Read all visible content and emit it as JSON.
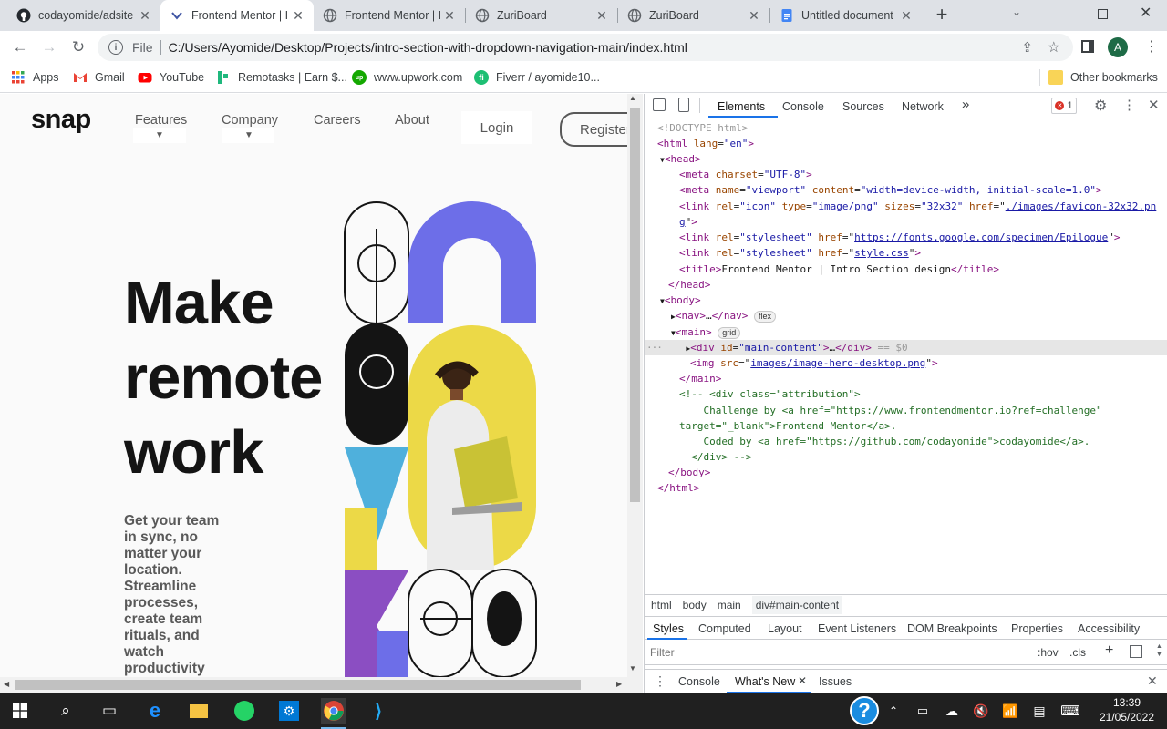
{
  "browser": {
    "tabs": [
      {
        "title": "codayomide/adsite",
        "icon": "github-icon"
      },
      {
        "title": "Frontend Mentor | I",
        "icon": "frontend-mentor-icon",
        "active": true
      },
      {
        "title": "Frontend Mentor | I",
        "icon": "globe-icon"
      },
      {
        "title": "ZuriBoard",
        "icon": "globe-icon"
      },
      {
        "title": "ZuriBoard",
        "icon": "globe-icon"
      },
      {
        "title": "Untitled document",
        "icon": "google-docs-icon"
      }
    ],
    "new_tab": "+",
    "address": {
      "scheme_label": "File",
      "url": "C:/Users/Ayomide/Desktop/Projects/intro-section-with-dropdown-navigation-main/index.html"
    },
    "profile_initial": "A",
    "bookmarks": [
      {
        "label": "Apps",
        "icon": "apps-grid-icon"
      },
      {
        "label": "Gmail",
        "icon": "gmail-icon"
      },
      {
        "label": "YouTube",
        "icon": "youtube-icon"
      },
      {
        "label": "Remotasks | Earn $...",
        "icon": "remotasks-icon"
      },
      {
        "label": "www.upwork.com",
        "icon": "upwork-icon"
      },
      {
        "label": "Fiverr / ayomide10...",
        "icon": "fiverr-icon"
      }
    ],
    "other_bookmarks": "Other bookmarks"
  },
  "site": {
    "logo": "snap",
    "nav": {
      "features": "Features",
      "company": "Company",
      "careers": "Careers",
      "about": "About"
    },
    "login": "Login",
    "register": "Register",
    "hero": {
      "line1": "Make",
      "line2": "remote",
      "line3": "work"
    },
    "description_lines": [
      "Get your team",
      "in sync, no",
      "matter your",
      "location.",
      "Streamline",
      "processes,",
      "create team",
      "rituals, and",
      "watch",
      "productivity"
    ],
    "colors": {
      "purple": "#6d6ee8",
      "yellow": "#ecd947",
      "blue": "#4fb0dc",
      "violet": "#8b4ec2",
      "dark": "#141414"
    }
  },
  "devtools": {
    "tabs": [
      "Elements",
      "Console",
      "Sources",
      "Network"
    ],
    "more": "»",
    "error_count": "1",
    "code": {
      "doctype": "<!DOCTYPE html>",
      "html_open": "html",
      "lang_attr": "lang",
      "lang_val": "\"en\"",
      "head": "head",
      "meta_charset": "charset",
      "meta_charset_val": "\"UTF-8\"",
      "meta_name": "name",
      "meta_name_val": "\"viewport\"",
      "meta_content": "content",
      "meta_content_val": "\"width=device-width, initial-scale=1.0\"",
      "link_rel": "rel",
      "icon_rel_val": "\"icon\"",
      "type_attr": "type",
      "type_val": "\"image/png\"",
      "sizes_attr": "sizes",
      "sizes_val": "\"32x32\"",
      "href_attr": "href",
      "favicon_href_a": "./images/favicon-32x32.pn",
      "favicon_href_b": "g",
      "stylesheet_val": "\"stylesheet\"",
      "fonts_href": "https://fonts.google.com/specimen/Epilogue",
      "style_href": "style.css",
      "title_text": "Frontend Mentor | Intro Section design",
      "nav_ellipsis": "…",
      "nav_badge": "flex",
      "main_badge": "grid",
      "div_id_attr": "id",
      "div_id_val": "\"main-content\"",
      "selected_suffix": "== $0",
      "img_src_attr": "src",
      "img_src_val": "images/image-hero-desktop.png",
      "comment1": "<!-- <div class=\"attribution\">",
      "comment2": "    Challenge by <a href=\"https://www.frontendmentor.io?ref=challenge\"",
      "comment3": "target=\"_blank\">Frontend Mentor</a>.",
      "comment4": "    Coded by <a href=\"https://github.com/codayomide\">codayomide</a>.",
      "comment5": "  </div> -->"
    },
    "breadcrumbs": [
      "html",
      "body",
      "main",
      "div#main-content"
    ],
    "subtabs": [
      "Styles",
      "Computed",
      "Layout",
      "Event Listeners",
      "DOM Breakpoints",
      "Properties",
      "Accessibility"
    ],
    "filter_placeholder": "Filter",
    "hov": ":hov",
    "cls": ".cls",
    "drawer_tabs": [
      "Console",
      "What's New",
      "Issues"
    ]
  },
  "taskbar": {
    "time": "13:39",
    "date": "21/05/2022",
    "help": "?"
  }
}
